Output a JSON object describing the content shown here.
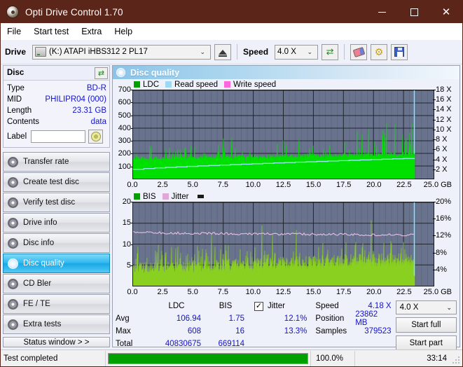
{
  "window": {
    "title": "Opti Drive Control 1.70",
    "icon": "disc-icon",
    "minimize": "—",
    "maximize": "□",
    "close": "✕"
  },
  "menu": {
    "items": [
      {
        "label": "File"
      },
      {
        "label": "Start test"
      },
      {
        "label": "Extra"
      },
      {
        "label": "Help"
      }
    ]
  },
  "toolbar": {
    "drive_label": "Drive",
    "drive_value": "(K:)  ATAPI iHBS312   2 PL17",
    "eject_icon": "eject-icon",
    "speed_label": "Speed",
    "speed_value": "4.0 X",
    "refresh_icon": "refresh-icon",
    "erase_icon": "erase-icon",
    "tools_icon": "tools-icon",
    "save_icon": "save-icon",
    "caret": "⌄"
  },
  "disc_panel": {
    "title": "Disc",
    "refresh_icon": "refresh-icon",
    "rows": [
      {
        "key": "Type",
        "value": "BD-R"
      },
      {
        "key": "MID",
        "value": "PHILIPR04 (000)"
      },
      {
        "key": "Length",
        "value": "23.31 GB"
      },
      {
        "key": "Contents",
        "value": "data"
      }
    ],
    "label_key": "Label",
    "label_value": "",
    "label_placeholder": "",
    "disc_button_icon": "cd-icon"
  },
  "sidebar": {
    "items": [
      {
        "label": "Transfer rate",
        "icon": "disc-icon",
        "active": false
      },
      {
        "label": "Create test disc",
        "icon": "disc-icon",
        "active": false
      },
      {
        "label": "Verify test disc",
        "icon": "disc-icon",
        "active": false
      },
      {
        "label": "Drive info",
        "icon": "disc-icon",
        "active": false
      },
      {
        "label": "Disc info",
        "icon": "disc-icon",
        "active": false
      },
      {
        "label": "Disc quality",
        "icon": "disc-icon",
        "active": true
      },
      {
        "label": "CD Bler",
        "icon": "disc-icon",
        "active": false
      },
      {
        "label": "FE / TE",
        "icon": "disc-icon",
        "active": false
      },
      {
        "label": "Extra tests",
        "icon": "disc-icon",
        "active": false
      }
    ],
    "status_window": "Status window > >"
  },
  "panel": {
    "title": "Disc quality",
    "icon": "disc-icon"
  },
  "stats": {
    "columns": [
      "LDC",
      "BIS"
    ],
    "rows": [
      {
        "key": "Avg",
        "ldc": "106.94",
        "bis": "1.75",
        "jitter": "12.1%"
      },
      {
        "key": "Max",
        "ldc": "608",
        "bis": "16",
        "jitter": "13.3%"
      },
      {
        "key": "Total",
        "ldc": "40830675",
        "bis": "669114",
        "jitter": ""
      }
    ],
    "jitter_label": "Jitter",
    "jitter_checked": "✓",
    "speed_key": "Speed",
    "speed_value": "4.18 X",
    "position_key": "Position",
    "position_value": "23862 MB",
    "samples_key": "Samples",
    "samples_value": "379523",
    "speed_select": "4.0 X",
    "start_full": "Start full",
    "start_part": "Start part",
    "caret": "⌄"
  },
  "statusbar": {
    "message": "Test completed",
    "progress_percent": "100.0%",
    "progress_value": 100,
    "elapsed": "33:14"
  },
  "colors": {
    "titlebar": "#5c2519",
    "accent_blue": "#1414cc",
    "plot_bg": "#69738d",
    "ldc_green": "#00e000",
    "bis_green": "#8ad020",
    "read_speed": "#9fe8f8",
    "write_speed": "#ff66dd",
    "jitter_pink": "#e8b8e0",
    "progress_green": "#00a000",
    "active_nav": "#16a8e6"
  },
  "chart_data": [
    {
      "type": "area",
      "title": "LDC / Read speed",
      "xlabel": "GB",
      "ylabel": "LDC",
      "xlim": [
        0.0,
        25.0
      ],
      "ylim": [
        0,
        700
      ],
      "y2lim": [
        0,
        18
      ],
      "y2label": "X",
      "grid": true,
      "legend_position": "top-left",
      "legend": [
        {
          "name": "LDC",
          "color": "#00a000"
        },
        {
          "name": "Read speed",
          "color": "#9fd8f0"
        },
        {
          "name": "Write speed",
          "color": "#ff66dd"
        }
      ],
      "xticks": [
        "0.0",
        "2.5",
        "5.0",
        "7.5",
        "10.0",
        "12.5",
        "15.0",
        "17.5",
        "20.0",
        "22.5",
        "25.0 GB"
      ],
      "yticks": [
        100,
        200,
        300,
        400,
        500,
        600,
        700
      ],
      "y2ticks": [
        "2 X",
        "4 X",
        "6 X",
        "8 X",
        "10 X",
        "12 X",
        "14 X",
        "16 X",
        "18 X"
      ],
      "data_end_x": 23.4,
      "series": [
        {
          "name": "LDC",
          "color": "#00e000",
          "baseline": 175,
          "values": [
            180,
            300,
            430,
            260,
            200,
            350,
            220,
            190,
            260,
            440,
            300,
            210,
            240,
            190,
            200,
            330,
            250,
            200,
            230,
            300,
            210,
            190,
            260,
            220,
            200,
            240,
            190,
            210,
            290,
            230,
            200,
            180,
            210,
            240,
            200,
            190,
            230,
            200,
            210,
            260,
            230,
            200,
            190,
            220,
            200,
            480,
            350,
            260,
            200,
            230,
            210,
            200,
            330,
            230,
            260,
            495,
            300,
            200,
            230,
            240,
            200,
            410,
            250,
            210,
            230,
            200,
            190,
            210,
            230,
            200,
            220,
            260,
            200,
            230,
            210,
            190,
            560,
            300,
            230,
            240,
            200,
            280,
            330,
            230,
            360,
            300,
            210,
            250,
            330,
            300,
            240,
            210,
            230,
            290,
            200,
            230,
            260,
            210,
            240,
            200,
            190,
            210,
            200,
            230,
            190,
            220,
            200,
            210,
            230,
            190,
            200,
            210,
            230,
            200,
            190,
            220,
            200,
            230,
            210,
            190,
            230,
            200,
            260,
            200,
            240,
            220,
            200,
            230,
            250,
            230,
            200,
            260,
            330,
            240,
            200,
            300,
            440,
            260,
            230,
            300,
            260,
            230,
            200,
            250,
            220,
            200,
            240,
            230,
            200,
            380,
            300,
            230,
            200,
            260,
            230,
            200,
            280,
            240,
            200,
            230,
            210,
            200,
            220,
            240,
            210,
            190,
            230,
            260,
            200,
            230,
            220,
            200,
            260,
            230,
            200,
            240,
            230,
            200,
            260,
            230,
            200,
            290,
            260,
            230,
            200,
            260,
            230,
            200,
            240,
            260,
            230,
            290,
            260,
            230,
            200,
            260,
            230,
            290,
            240,
            300,
            260,
            230,
            290,
            330,
            300,
            260,
            290,
            330,
            300,
            340,
            300,
            260,
            290,
            330,
            360,
            300,
            260,
            290,
            330,
            300,
            260,
            290,
            330,
            370,
            300,
            490,
            400,
            330,
            300,
            430,
            545,
            400,
            330,
            300,
            360,
            400,
            330,
            300,
            360,
            608,
            430,
            360,
            300,
            330,
            360,
            330,
            300,
            360,
            430,
            400,
            330,
            300,
            330,
            360,
            430,
            300
          ]
        },
        {
          "name": "Read speed",
          "color": "#9fe8f8",
          "units": "X",
          "start_value": 1.9,
          "end_value": 4.18,
          "shape": "stepped-increasing"
        },
        {
          "name": "Write speed",
          "color": "#ff66dd",
          "values": []
        }
      ]
    },
    {
      "type": "area",
      "title": "BIS / Jitter",
      "xlabel": "GB",
      "ylabel": "BIS",
      "xlim": [
        0.0,
        25.0
      ],
      "ylim": [
        0,
        20
      ],
      "y2lim": [
        0,
        20
      ],
      "y2label": "%",
      "grid": true,
      "legend_position": "top-left",
      "legend": [
        {
          "name": "BIS",
          "color": "#00a000"
        },
        {
          "name": "Jitter",
          "color": "#e0a8d8"
        }
      ],
      "xticks": [
        "0.0",
        "2.5",
        "5.0",
        "7.5",
        "10.0",
        "12.5",
        "15.0",
        "17.5",
        "20.0",
        "22.5",
        "25.0 GB"
      ],
      "yticks": [
        5,
        10,
        15,
        20
      ],
      "y2ticks": [
        "4%",
        "8%",
        "12%",
        "16%",
        "20%"
      ],
      "data_end_x": 23.4,
      "series": [
        {
          "name": "BIS",
          "color": "#8ad020",
          "baseline": 4.5,
          "max": 16,
          "avg": 1.75
        },
        {
          "name": "Jitter",
          "color": "#e8b8e0",
          "units": "%",
          "start_value": 12.9,
          "end_value": 12.2,
          "avg": 12.1,
          "max": 13.3
        }
      ]
    }
  ]
}
